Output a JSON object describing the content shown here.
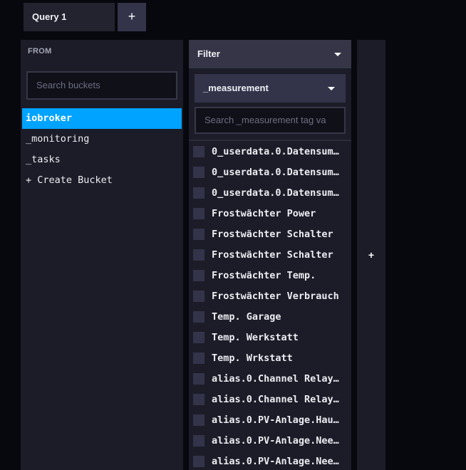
{
  "query_tab": {
    "label": "Query 1",
    "add_label": "+"
  },
  "from_panel": {
    "title": "FROM",
    "search_placeholder": "Search buckets",
    "buckets": [
      {
        "label": "iobroker",
        "selected": true
      },
      {
        "label": "_monitoring",
        "selected": false
      },
      {
        "label": "_tasks",
        "selected": false
      },
      {
        "label": "+ Create Bucket",
        "selected": false
      }
    ]
  },
  "filter_panel": {
    "title": "Filter",
    "tag_key": "_measurement",
    "search_placeholder": "Search _measurement tag va",
    "values": [
      "0_userdata.0.Datensum…",
      "0_userdata.0.Datensum…",
      "0_userdata.0.Datensum…",
      "Frostwächter Power",
      "Frostwächter Schalter",
      "Frostwächter Schalter",
      "Frostwächter Temp.",
      "Frostwächter Verbrauch",
      "Temp. Garage",
      "Temp. Werkstatt",
      "Temp. Wrkstatt",
      "alias.0.Channel Relay…",
      "alias.0.Channel Relay…",
      "alias.0.PV-Anlage.Hau…",
      "alias.0.PV-Anlage.Nee…",
      "alias.0.PV-Anlage.Nee…"
    ]
  },
  "add_filter_label": "+",
  "colors": {
    "accent": "#00a3ff",
    "panel": "#1b1c27",
    "background": "#07080d"
  },
  "icons": {
    "dropdown": "caret-down-icon",
    "add": "plus-icon",
    "checkbox": "checkbox-icon"
  }
}
